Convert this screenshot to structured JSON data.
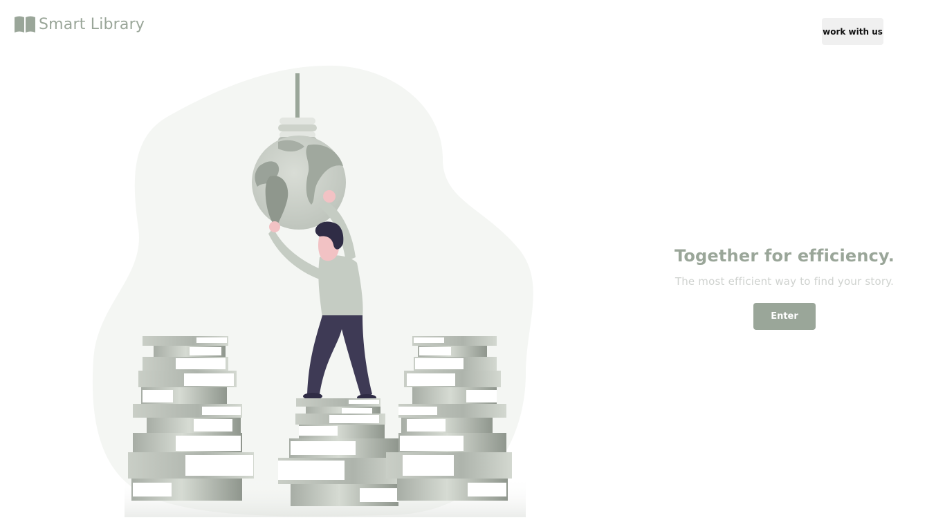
{
  "header": {
    "logo_icon": "open-book-icon",
    "logo_text": "Smart Library",
    "work_button_label": "work with us"
  },
  "hero": {
    "title": "Together for efficiency.",
    "subtitle": "The most efficient way to find your story.",
    "enter_label": "Enter"
  },
  "illustration": {
    "subject": "person holding globe lightbulb standing on stacks of books"
  },
  "colors": {
    "brand": "#9aa699",
    "muted_text": "#cfd2cf",
    "button_bg": "#f0f0f0",
    "pants": "#3e3a55",
    "blob": "#f4f6f3"
  }
}
